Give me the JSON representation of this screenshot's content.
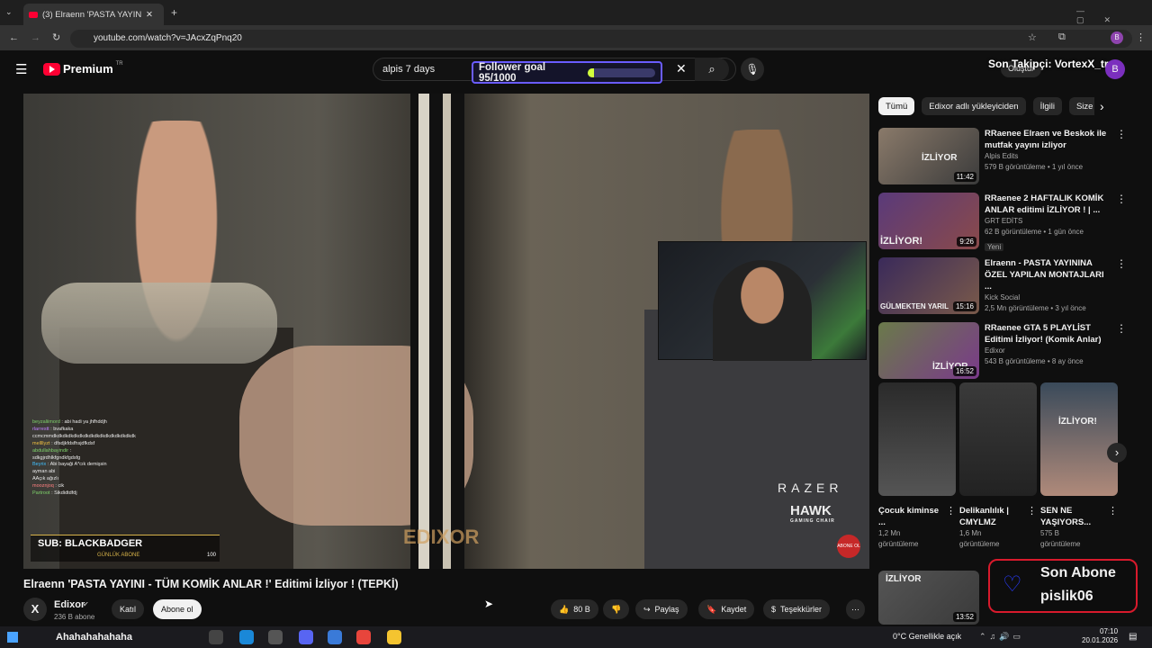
{
  "browser": {
    "tab_title": "(3) Elraenn 'PASTA YAYINI -",
    "url": "youtube.com/watch?v=JAcxZqPnq20",
    "profile_initial": "B"
  },
  "youtube": {
    "logo": "Premium",
    "logo_region": "TR",
    "search_query": "alpis 7 days",
    "create_label": "Oluştur",
    "avatar_initial": "B"
  },
  "overlay": {
    "follower_goal": "Follower goal 95/1000",
    "follower_goal_progress": 0.095,
    "last_follower": "Son Takipçi: VortexX_tr",
    "sub_banner": "SUB: BLACKBADGER",
    "sub_banner2": "GÜNLÜK ABONE",
    "sub_count": "100",
    "brand1": "RAZER",
    "brand2": "HAWK",
    "brand2_sub": "GAMING CHAIR",
    "watermark": "EDIXOR",
    "abone_badge": "ABONE OL",
    "last_sub_title": "Son Abone",
    "last_sub_name": "pislik06"
  },
  "chat": [
    {
      "user": "beyzaliimord",
      "msg": "abi hadi ya jhfhddjh"
    },
    {
      "user": "rlarrestt",
      "msg": "bvafkaka"
    },
    {
      "user": "",
      "msg": "ccmcmmdkdkdkdkdkdkdkdkdkdkdkdkdkdkdkdk"
    },
    {
      "user": "mellllyzt",
      "msg": "dfsdjkfdsfhsjdfkdsf"
    },
    {
      "user": "abdullahbayindir",
      "msg": ""
    },
    {
      "user": "",
      "msg": "sdkgjrdhlkfgndkfgdsfg"
    },
    {
      "user": "Beyrix",
      "msg": "Abi bayaği A*cık demişsin"
    },
    {
      "user": "",
      "msg": "ayman abi"
    },
    {
      "user": "",
      "msg": "AAçık ağızlı"
    },
    {
      "user": "mooznjoq",
      "msg": "cik"
    },
    {
      "user": "Partroot",
      "msg": "Sikdidtdfdj"
    }
  ],
  "video": {
    "title": "Elraenn 'PASTA YAYINI - TÜM KOMİK ANLAR !' Editimi İzliyor ! (TEPKİ)",
    "channel": "Edixor",
    "subs": "236 B abone",
    "join": "Katıl",
    "subscribe": "Abone ol",
    "likes": "80 B",
    "share": "Paylaş",
    "save": "Kaydet",
    "thanks": "Teşekkürler"
  },
  "filters": [
    "Tümü",
    "Edixor adlı yükleyiciden",
    "İlgili",
    "Size"
  ],
  "related": [
    {
      "title": "RRaenee Elraen ve Beskok ile mutfak yayını izliyor",
      "channel": "Alpis Edits",
      "meta": "579 B görüntüleme • 1 yıl önce",
      "duration": "11:42",
      "badge": "",
      "thumb_text": "İZLİYOR"
    },
    {
      "title": "RRaenee 2 HAFTALIK KOMİK ANLAR editimi İZLİYOR ! | ...",
      "channel": "GRT EDİTS",
      "meta": "62 B görüntüleme • 1 gün önce",
      "duration": "9:26",
      "badge": "Yeni",
      "thumb_text": "İZLİYOR!"
    },
    {
      "title": "Elraenn - PASTA YAYININA ÖZEL YAPILAN MONTAJLARI ...",
      "channel": "Kick Social",
      "meta": "2,5 Mn görüntüleme • 3 yıl önce",
      "duration": "15:16",
      "badge": "",
      "thumb_text": "GÜLMEKTEN YARIL"
    },
    {
      "title": "RRaenee GTA 5 PLAYLİST Editimi İzliyor! (Komik Anlar)",
      "channel": "Edixor",
      "meta": "543 B görüntüleme • 8 ay önce",
      "duration": "16:52",
      "badge": "",
      "thumb_text": "İZLİYOR"
    }
  ],
  "shorts": [
    {
      "title": "Çocuk kiminse ...",
      "views": "1,2 Mn",
      "views_label": "görüntüleme"
    },
    {
      "title": "Delikanlılık | CMYLMZ",
      "views": "1,6 Mn",
      "views_label": "görüntüleme"
    },
    {
      "title": "SEN NE YAŞIYORS...",
      "views": "575 B",
      "views_label": "görüntüleme",
      "thumb_text": "İZLİYOR!"
    }
  ],
  "related_partial": {
    "duration": "13:52",
    "thumb_text": "İZLİYOR"
  },
  "taskbar": {
    "now_playing": "Ahahahahahaha",
    "weather": "0°C Genellikle açık",
    "time": "07:10",
    "date": "20.01.2026"
  },
  "colors": {
    "accent": "#6a5cff",
    "youtube_red": "#ff0033",
    "goal_fill": "#d2ff3c",
    "sub_border": "#d81a2c"
  }
}
